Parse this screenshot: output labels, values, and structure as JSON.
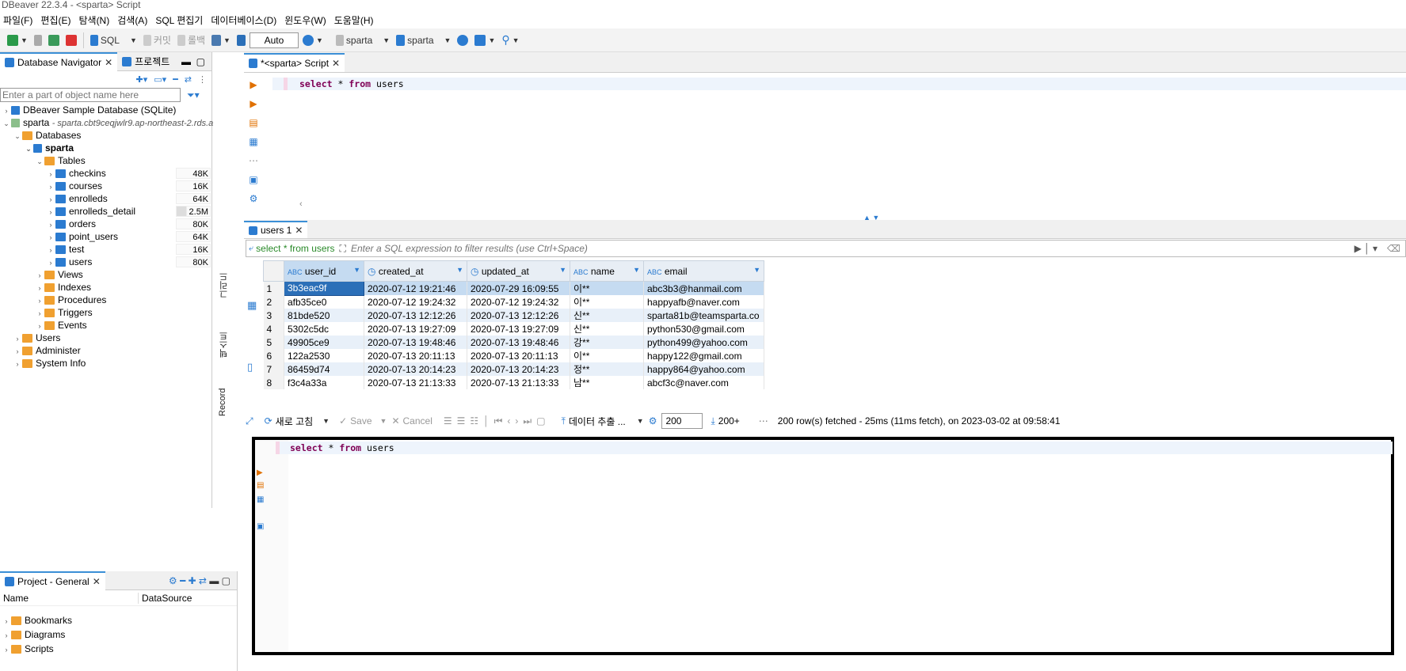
{
  "window": {
    "title": "DBeaver 22.3.4 - <sparta> Script"
  },
  "menu": [
    "파일(F)",
    "편집(E)",
    "탐색(N)",
    "검색(A)",
    "SQL 편집기",
    "데이터베이스(D)",
    "윈도우(W)",
    "도움말(H)"
  ],
  "toolbar": {
    "sql_label": "SQL",
    "commit_label": "커밋",
    "rollback_label": "롤백",
    "auto_label": "Auto",
    "datasource_label": "sparta",
    "schema_label": "sparta"
  },
  "navigator": {
    "tab_label": "Database Navigator",
    "project_tab_label": "프로젝트",
    "filter_placeholder": "Enter a part of object name here",
    "sample_db": "DBeaver Sample Database (SQLite)",
    "conn_name": "sparta",
    "conn_detail": "- sparta.cbt9ceqjwlr9.ap-northeast-2.rds.a",
    "databases": "Databases",
    "db_name": "sparta",
    "tables_label": "Tables",
    "tables": [
      {
        "name": "checkins",
        "size": "48K"
      },
      {
        "name": "courses",
        "size": "16K"
      },
      {
        "name": "enrolleds",
        "size": "64K"
      },
      {
        "name": "enrolleds_detail",
        "size": "2.5M"
      },
      {
        "name": "orders",
        "size": "80K"
      },
      {
        "name": "point_users",
        "size": "64K"
      },
      {
        "name": "test",
        "size": "16K"
      },
      {
        "name": "users",
        "size": "80K"
      }
    ],
    "folders": [
      "Views",
      "Indexes",
      "Procedures",
      "Triggers",
      "Events"
    ],
    "roots": [
      "Users",
      "Administer",
      "System Info"
    ]
  },
  "project": {
    "tab_label": "Project - General",
    "col_name": "Name",
    "col_datasource": "DataSource",
    "items": [
      "Bookmarks",
      "Diagrams",
      "Scripts"
    ]
  },
  "editor": {
    "tab_label": "*<sparta> Script",
    "sql_select": "select",
    "sql_star": "*",
    "sql_from": "from",
    "sql_table": "users"
  },
  "results": {
    "tab_label": "users 1",
    "filter_query": "select * from users",
    "filter_placeholder": "Enter a SQL expression to filter results (use Ctrl+Space)",
    "side_tabs": [
      "그리드",
      "텍스트",
      "Record"
    ],
    "columns": [
      {
        "type": "ABC",
        "name": "user_id"
      },
      {
        "type": "clock",
        "name": "created_at"
      },
      {
        "type": "clock",
        "name": "updated_at"
      },
      {
        "type": "ABC",
        "name": "name"
      },
      {
        "type": "ABC",
        "name": "email"
      }
    ],
    "rows": [
      [
        "1",
        "3b3eac9f",
        "2020-07-12 19:21:46",
        "2020-07-29 16:09:55",
        "이**",
        "abc3b3@hanmail.com"
      ],
      [
        "2",
        "afb35ce0",
        "2020-07-12 19:24:32",
        "2020-07-12 19:24:32",
        "이**",
        "happyafb@naver.com"
      ],
      [
        "3",
        "81bde520",
        "2020-07-13 12:12:26",
        "2020-07-13 12:12:26",
        "신**",
        "sparta81b@teamsparta.co"
      ],
      [
        "4",
        "5302c5dc",
        "2020-07-13 19:27:09",
        "2020-07-13 19:27:09",
        "신**",
        "python530@gmail.com"
      ],
      [
        "5",
        "49905ce9",
        "2020-07-13 19:48:46",
        "2020-07-13 19:48:46",
        "강**",
        "python499@yahoo.com"
      ],
      [
        "6",
        "122a2530",
        "2020-07-13 20:11:13",
        "2020-07-13 20:11:13",
        "이**",
        "happy122@gmail.com"
      ],
      [
        "7",
        "86459d74",
        "2020-07-13 20:14:23",
        "2020-07-13 20:14:23",
        "정**",
        "happy864@yahoo.com"
      ],
      [
        "8",
        "f3c4a33a",
        "2020-07-13 21:13:33",
        "2020-07-13 21:13:33",
        "남**",
        "abcf3c@naver.com"
      ]
    ],
    "refresh_label": "새로 고침",
    "save_label": "Save",
    "cancel_label": "Cancel",
    "export_label": "데이터 추출 ...",
    "fetch_size": "200",
    "fetch_more": "200+",
    "status": "200 row(s) fetched - 25ms (11ms fetch), on 2023-03-02 at 09:58:41"
  },
  "zoom_editor": {
    "sql_select": "select",
    "sql_star": "*",
    "sql_from": "from",
    "sql_table": "users"
  },
  "colors": {
    "accent": "#3b8fd6",
    "keyword": "#7f0055",
    "selected_row": "#c5dbf1",
    "even_row": "#e8f0f9",
    "folder": "#f0a030",
    "table_icon": "#2b7bd0"
  }
}
